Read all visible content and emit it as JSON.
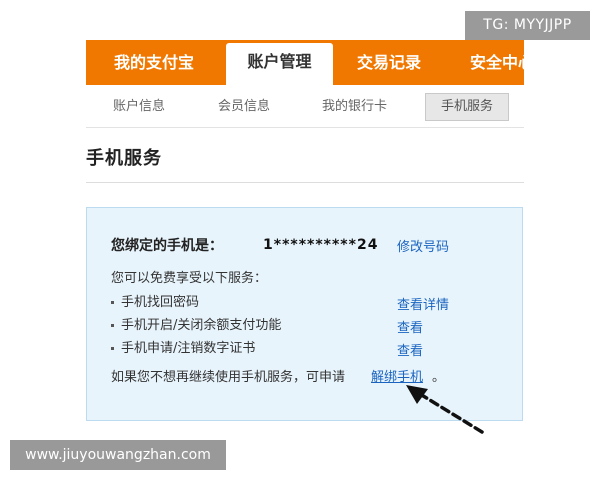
{
  "watermark": {
    "tg": "TG: MYYJJPP",
    "site": "www.jiuyouwangzhan.com"
  },
  "main_nav": {
    "tabs": [
      {
        "label": "我的支付宝"
      },
      {
        "label": "账户管理"
      },
      {
        "label": "交易记录"
      },
      {
        "label": "安全中心"
      }
    ],
    "active_index": 1
  },
  "sub_nav": {
    "tabs": [
      {
        "label": "账户信息"
      },
      {
        "label": "会员信息"
      },
      {
        "label": "我的银行卡"
      },
      {
        "label": "手机服务"
      }
    ],
    "active_index": 3
  },
  "page_title": "手机服务",
  "phone_panel": {
    "label": "您绑定的手机是：",
    "number": "1**********24",
    "modify_link": "修改号码",
    "intro": "您可以免费享受以下服务：",
    "services": [
      {
        "text": "手机找回密码",
        "link": "查看详情"
      },
      {
        "text": "手机开启/关闭余额支付功能",
        "link": "查看"
      },
      {
        "text": "手机申请/注销数字证书",
        "link": "查看"
      }
    ],
    "footer_text": "如果您不想再继续使用手机服务，可申请",
    "unbind_link": "解绑手机",
    "period": "。"
  },
  "colors": {
    "nav_orange": "#f07800",
    "panel_bg": "#e8f4fc",
    "link_blue": "#1a64c0"
  },
  "annotation_icon": "dashed-arrow-pointer-icon"
}
